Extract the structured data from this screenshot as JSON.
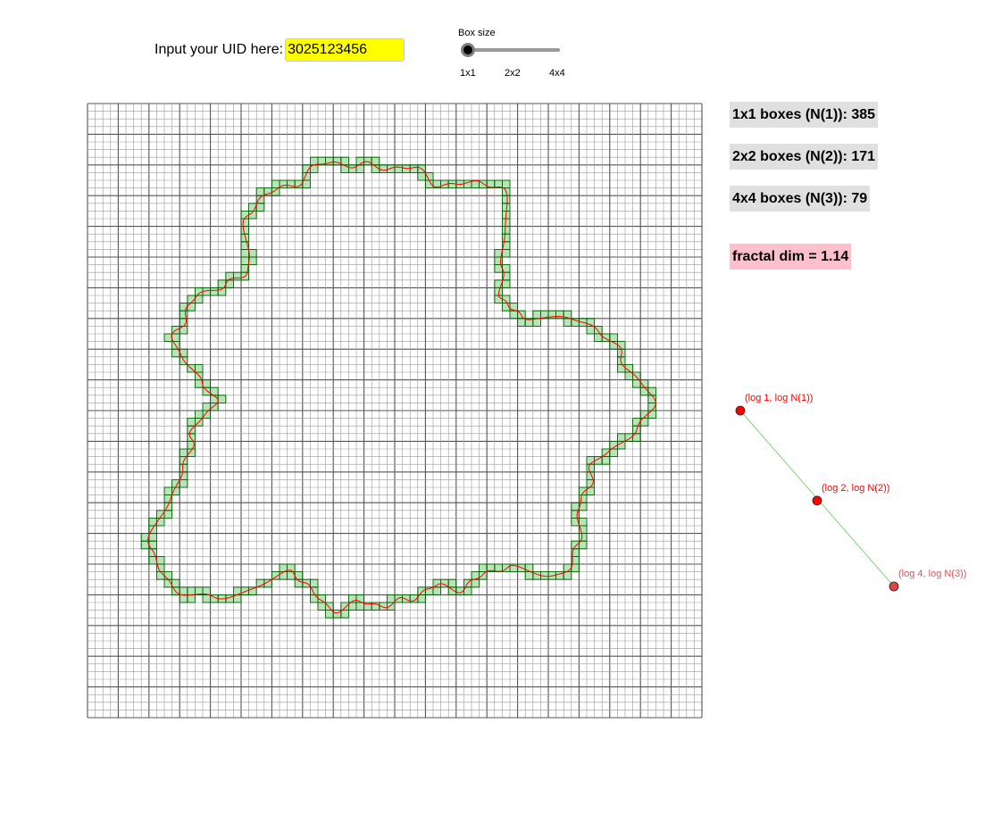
{
  "uid": {
    "label": "Input your UID here:",
    "value": "3025123456"
  },
  "box_size_slider": {
    "label": "Box size",
    "options": [
      "1x1",
      "2x2",
      "4x4"
    ],
    "selected": "1x1"
  },
  "stats": {
    "n1": "1x1 boxes (N(1)): 385",
    "n2": "2x2 boxes (N(2)): 171",
    "n3": "4x4 boxes (N(3)): 79",
    "fractal_dim": "fractal dim = 1.14"
  },
  "loglog_points": [
    {
      "label": "(log 1, log N(1))",
      "log_s": 0,
      "log_n": 5.953
    },
    {
      "label": "(log 2, log N(2))",
      "log_s": 0.693,
      "log_n": 5.142
    },
    {
      "label": "(log 4, log N(3))",
      "log_s": 1.386,
      "log_n": 4.369
    }
  ],
  "grid": {
    "cells": 80,
    "major_every": 4
  },
  "colors": {
    "uid_input_bg": "#ffff00",
    "stat_bg": "#e0e0e0",
    "fractal_bg": "#ffc0cb",
    "curve": "#ff0000",
    "box_fill": "#b9e3b9",
    "box_stroke": "#006400",
    "fit_line": "#7fd47f",
    "point_fill": "#ff0000",
    "point_fill_faded": "#dd4444",
    "label_faded": "#e0505a"
  }
}
